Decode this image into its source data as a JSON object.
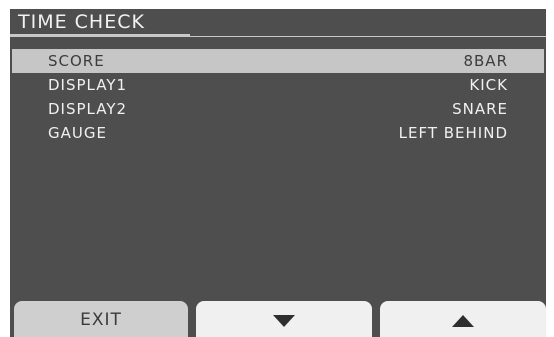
{
  "screen": {
    "title": "TIME CHECK"
  },
  "params": [
    {
      "label": "SCORE",
      "value": "8BAR",
      "selected": true
    },
    {
      "label": "DISPLAY1",
      "value": "KICK",
      "selected": false
    },
    {
      "label": "DISPLAY2",
      "value": "SNARE",
      "selected": false
    },
    {
      "label": "GAUGE",
      "value": "LEFT BEHIND",
      "selected": false
    }
  ],
  "softkeys": {
    "exit_label": "EXIT",
    "down_icon": "triangle-down-icon",
    "up_icon": "triangle-up-icon"
  },
  "colors": {
    "screen_bg": "#4e4e4e",
    "highlight_bg": "#c6c6c6",
    "text": "#f0f0f0",
    "softkey_bg": "#f0f0f0"
  }
}
